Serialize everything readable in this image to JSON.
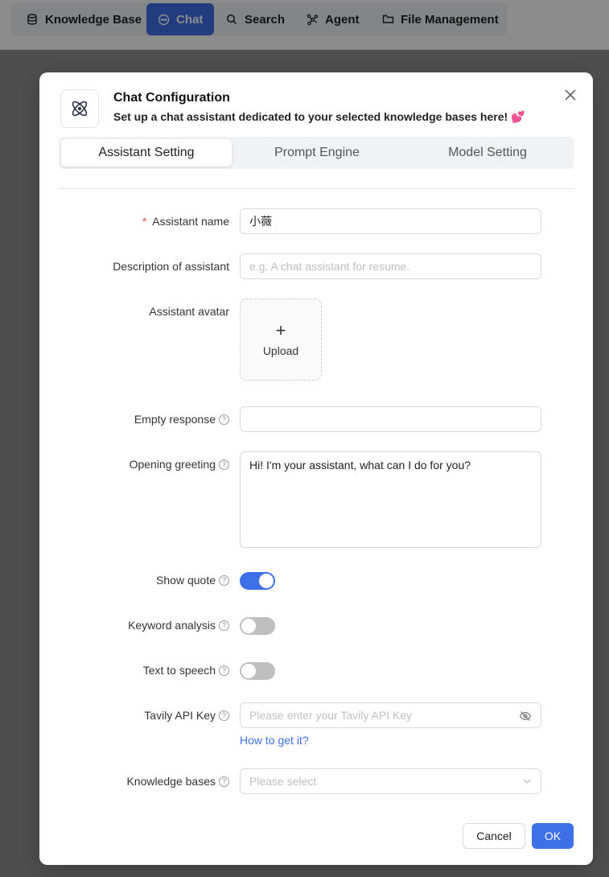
{
  "nav": {
    "items": [
      {
        "label": "Knowledge Base",
        "icon": "database-icon"
      },
      {
        "label": "Chat",
        "icon": "chat-bubble-icon",
        "active": true
      },
      {
        "label": "Search",
        "icon": "search-icon"
      },
      {
        "label": "Agent",
        "icon": "agent-graph-icon"
      },
      {
        "label": "File Management",
        "icon": "folder-icon"
      }
    ]
  },
  "modal": {
    "title": "Chat Configuration",
    "subtitle": "Set up a chat assistant dedicated to your selected knowledge bases here!",
    "subtitle_emoji": "💕",
    "tabs": [
      "Assistant Setting",
      "Prompt Engine",
      "Model Setting"
    ],
    "active_tab": "Assistant Setting"
  },
  "form": {
    "assistant_name": {
      "label": "Assistant name",
      "required": true,
      "value": "小薇"
    },
    "description": {
      "label": "Description of assistant",
      "placeholder": "e.g. A chat assistant for resume."
    },
    "avatar": {
      "label": "Assistant avatar",
      "upload_label": "Upload"
    },
    "empty_response": {
      "label": "Empty response",
      "value": ""
    },
    "opening_greeting": {
      "label": "Opening greeting",
      "value": "Hi! I'm your assistant, what can I do for you?"
    },
    "show_quote": {
      "label": "Show quote",
      "on": true
    },
    "keyword_analysis": {
      "label": "Keyword analysis",
      "on": false
    },
    "text_to_speech": {
      "label": "Text to speech",
      "on": false
    },
    "tavily_api_key": {
      "label": "Tavily API Key",
      "placeholder": "Please enter your Tavily API Key",
      "help_link": "How to get it?"
    },
    "knowledge_bases": {
      "label": "Knowledge bases",
      "placeholder": "Please select"
    }
  },
  "footer": {
    "cancel_label": "Cancel",
    "ok_label": "OK"
  },
  "colors": {
    "primary": "#3c6fe8",
    "required": "#e5484d",
    "heart": "#e8487f"
  }
}
